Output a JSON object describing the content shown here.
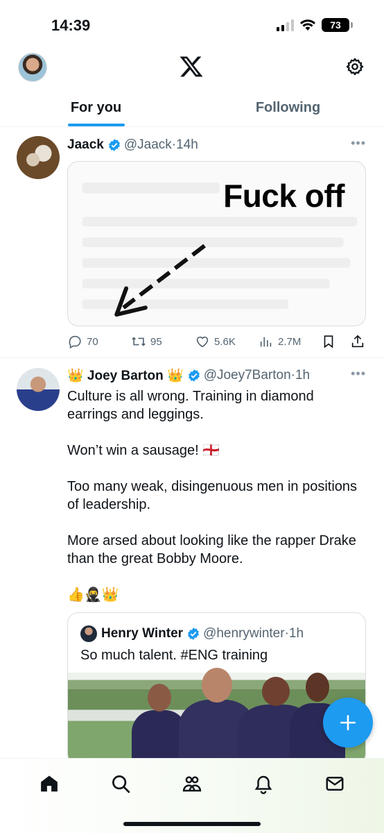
{
  "status": {
    "time": "14:39",
    "battery": "73"
  },
  "header": {
    "logo": "x-logo",
    "settings_icon": "gear-icon"
  },
  "tabs": [
    {
      "label": "For you",
      "active": true
    },
    {
      "label": "Following",
      "active": false
    }
  ],
  "tweets": [
    {
      "name": "Jaack",
      "handle": "@Jaack",
      "time": "14h",
      "meme_text": "Fuck off",
      "stats": {
        "replies": "70",
        "reposts": "95",
        "likes": "5.6K",
        "views": "2.7M"
      }
    },
    {
      "name": "👑 Joey Barton 👑",
      "handle": "@Joey7Barton",
      "time": "1h",
      "text": "Culture is all wrong. Training in diamond earrings and leggings.\n\nWon’t win a sausage! 🏴󠁧󠁢󠁥󠁮󠁧󠁿\n\nToo many weak, disingenuous men in positions of leadership.\n\nMore arsed about looking like the rapper Drake than the great Bobby Moore.\n\n👍🥷👑",
      "quote": {
        "name": "Henry Winter",
        "handle": "@henrywinter",
        "time": "1h",
        "text": "So much talent. #ENG training"
      }
    }
  ],
  "bottom_nav": [
    "home-icon",
    "search-icon",
    "communities-icon",
    "notifications-icon",
    "messages-icon"
  ],
  "colors": {
    "accent": "#1d9bf0",
    "text": "#0f1419",
    "muted": "#536471"
  }
}
